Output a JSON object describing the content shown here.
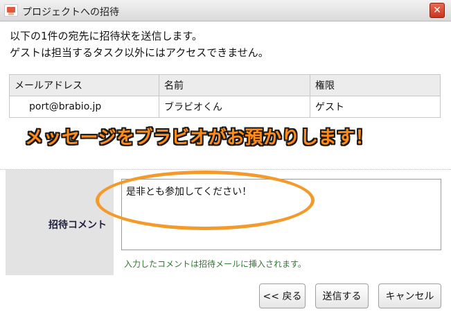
{
  "window": {
    "title": "プロジェクトへの招待",
    "close_symbol": "✕"
  },
  "intro": {
    "line1": "以下の1件の宛先に招待状を送信します。",
    "line2": "ゲストは担当するタスク以外にはアクセスできません。"
  },
  "recipients": {
    "headers": [
      "メールアドレス",
      "名前",
      "権限"
    ],
    "rows": [
      {
        "email": "port@brabio.jp",
        "name": "ブラビオくん",
        "permission": "ゲスト"
      }
    ]
  },
  "banner": {
    "text": "メッセージをブラビオがお預かりします！"
  },
  "comment": {
    "label": "招待コメント",
    "value": "是非とも参加してください！",
    "hint": "入力したコメントは招待メールに挿入されます。"
  },
  "buttons": {
    "back": "<< 戻る",
    "send": "送信する",
    "cancel": "キャンセル"
  },
  "colors": {
    "banner_fill": "#ff8c1a",
    "highlight_ring": "#f39a2b",
    "close_button": "#d9422b",
    "hint_text": "#2f7a2f"
  },
  "icons": {
    "app": "invitation-mail-icon",
    "close": "close-icon"
  }
}
